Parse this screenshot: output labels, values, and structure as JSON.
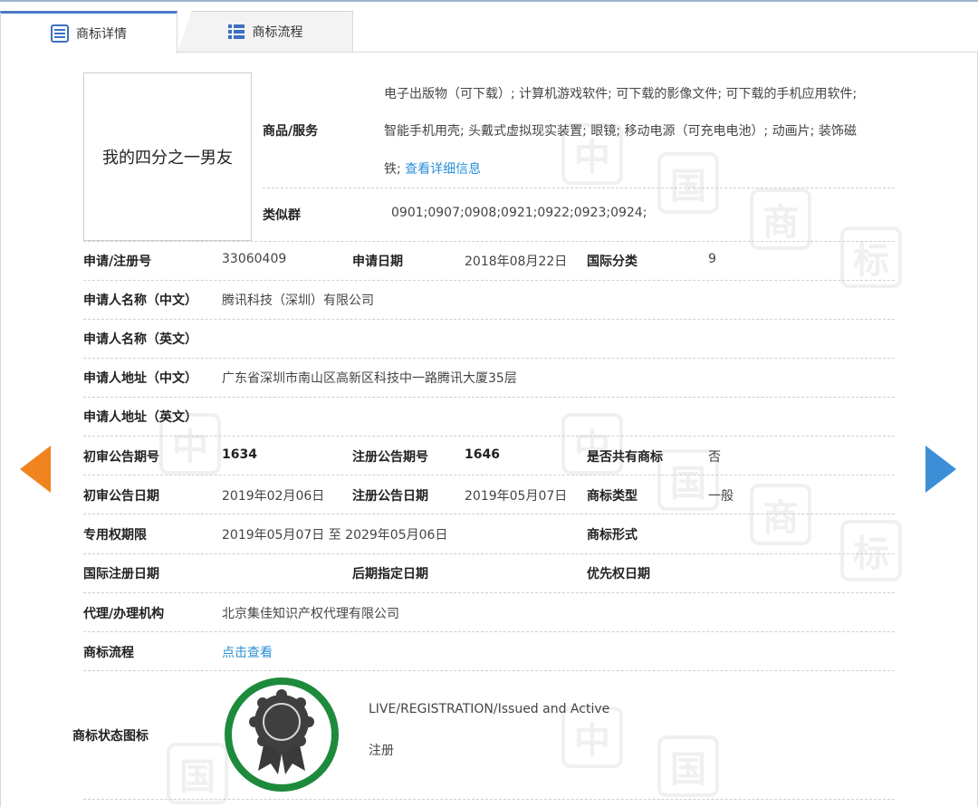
{
  "tabs": [
    {
      "label": "商标详情",
      "active": true
    },
    {
      "label": "商标流程",
      "active": false
    }
  ],
  "trademark_text": "我的四分之一男友",
  "goods": {
    "label": "商品/服务",
    "line1": "电子出版物（可下载）; 计算机游戏软件; 可下载的影像文件; 可下载的手机应用软件;",
    "line2": "智能手机用壳; 头戴式虚拟现实装置; 眼镜; 移动电源（可充电电池）; 动画片; 装饰磁",
    "line3": "铁;",
    "detail_link": "查看详细信息"
  },
  "similar_group": {
    "label": "类似群",
    "value": "0901;0907;0908;0921;0922;0923;0924;"
  },
  "fields": {
    "reg_no_label": "申请/注册号",
    "reg_no": "33060409",
    "apply_date_label": "申请日期",
    "apply_date": "2018年08月22日",
    "intl_class_label": "国际分类",
    "intl_class": "9",
    "applicant_cn_label": "申请人名称（中文）",
    "applicant_cn": "腾讯科技（深圳）有限公司",
    "applicant_en_label": "申请人名称（英文）",
    "applicant_en": "",
    "address_cn_label": "申请人地址（中文）",
    "address_cn": "广东省深圳市南山区高新区科技中一路腾讯大厦35层",
    "address_en_label": "申请人地址（英文）",
    "address_en": "",
    "prelim_no_label": "初审公告期号",
    "prelim_no": "1634",
    "reg_pub_no_label": "注册公告期号",
    "reg_pub_no": "1646",
    "shared_label": "是否共有商标",
    "shared": "否",
    "prelim_date_label": "初审公告日期",
    "prelim_date": "2019年02月06日",
    "reg_pub_date_label": "注册公告日期",
    "reg_pub_date": "2019年05月07日",
    "tm_type_label": "商标类型",
    "tm_type": "一般",
    "exclusive_label": "专用权期限",
    "exclusive": "2019年05月07日 至 2029年05月06日",
    "tm_form_label": "商标形式",
    "tm_form": "",
    "intl_reg_date_label": "国际注册日期",
    "intl_reg_date": "",
    "later_date_label": "后期指定日期",
    "later_date": "",
    "priority_date_label": "优先权日期",
    "priority_date": "",
    "agent_label": "代理/办理机构",
    "agent": "北京集佳知识产权代理有限公司",
    "flow_label": "商标流程",
    "flow_link": "点击查看",
    "status_label": "商标状态图标",
    "status_en": "LIVE/REGISTRATION/Issued and Active",
    "status_cn": "注册"
  },
  "colors": {
    "accent_orange": "#f0841f",
    "accent_blue": "#3c8fd6",
    "link": "#2a8fd8",
    "badge_green": "#1e8a3c"
  }
}
